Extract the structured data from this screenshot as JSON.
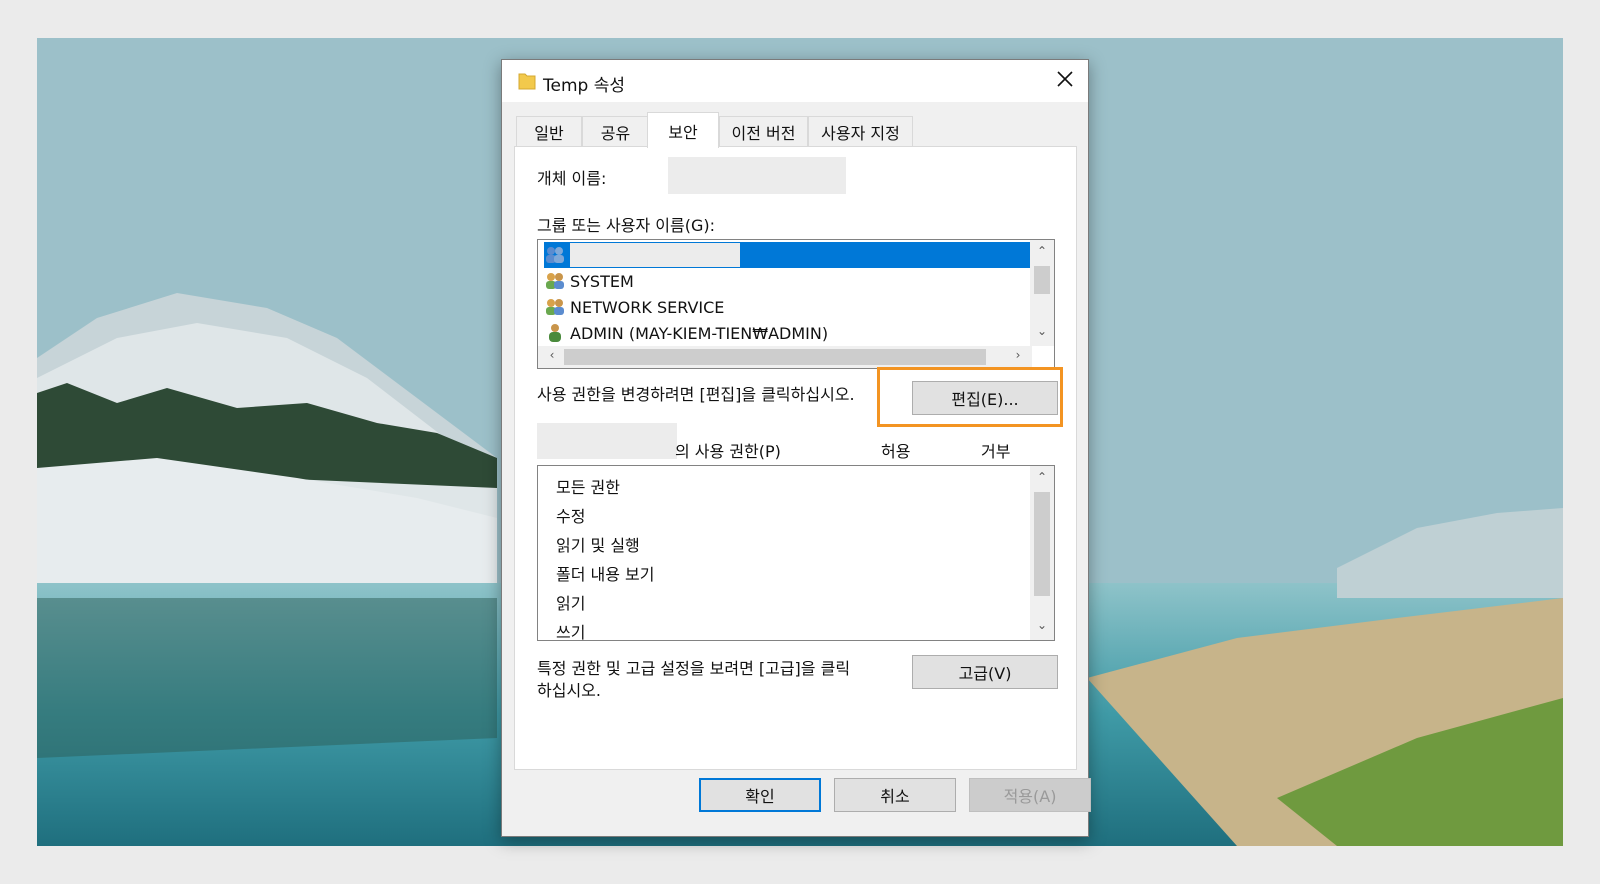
{
  "window": {
    "title": "Temp 속성",
    "close_label": "✕"
  },
  "tabs": [
    {
      "label": "일반",
      "active": false
    },
    {
      "label": "공유",
      "active": false
    },
    {
      "label": "보안",
      "active": true
    },
    {
      "label": "이전 버전",
      "active": false
    },
    {
      "label": "사용자 지정",
      "active": false
    }
  ],
  "security": {
    "object_name_label": "개체 이름:",
    "object_name_value": "",
    "groups_label": "그룹 또는 사용자 이름(G):",
    "users": [
      {
        "name": "",
        "icon": "group-icon",
        "selected": true
      },
      {
        "name": "SYSTEM",
        "icon": "group-icon",
        "selected": false
      },
      {
        "name": "NETWORK SERVICE",
        "icon": "group-icon",
        "selected": false
      },
      {
        "name": "ADMIN (MAY-KIEM-TIEN₩ADMIN)",
        "icon": "user-icon",
        "selected": false
      }
    ],
    "edit_hint": "사용 권한을 변경하려면 [편집]을 클릭하십시오.",
    "edit_button": "편집(E)...",
    "permissions_for_suffix": "의 사용 권한(P)",
    "allow_header": "허용",
    "deny_header": "거부",
    "permissions": [
      "모든 권한",
      "수정",
      "읽기 및 실행",
      "폴더 내용 보기",
      "읽기",
      "쓰기"
    ],
    "advanced_hint_line1": "특정 권한 및 고급 설정을 보려면 [고급]을 클릭",
    "advanced_hint_line2": "하십시오.",
    "advanced_button": "고급(V)"
  },
  "footer": {
    "ok": "확인",
    "cancel": "취소",
    "apply": "적용(A)"
  },
  "colors": {
    "selection": "#0078d7",
    "highlight_box": "#f39422"
  }
}
